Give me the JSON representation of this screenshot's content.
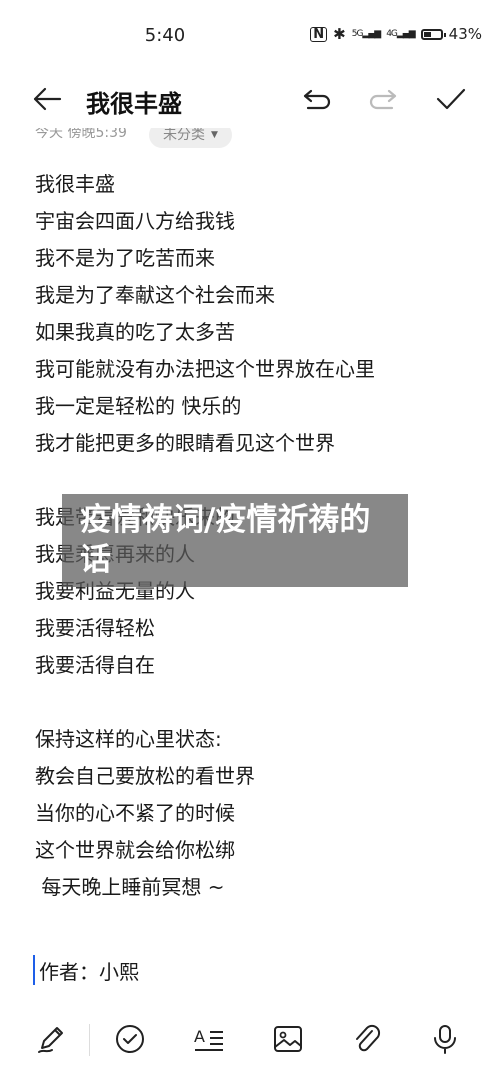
{
  "status_bar": {
    "time": "5:40",
    "battery_percent": "43%",
    "signal_1": "5G",
    "signal_2": "4G"
  },
  "toolbar": {
    "title": "我很丰盛"
  },
  "meta": {
    "date": "今天 傍晚5:39",
    "category": "未分类"
  },
  "note": {
    "lines": [
      "我很丰盛",
      "宇宙会四面八方给我钱",
      "我不是为了吃苦而来",
      "我是为了奉献这个社会而来",
      "如果我真的吃了太多苦",
      "我可能就没有办法把这个世界放在心里",
      "我一定是轻松的 快乐的",
      "我才能把更多的眼睛看见这个世界",
      "",
      "我是带着爱和快乐来的",
      "我是乘愿再来的人",
      "我要利益无量的人",
      "我要活得轻松",
      "我要活得自在",
      "",
      "保持这样的心里状态:",
      "教会自己要放松的看世界",
      "当你的心不紧了的时候",
      "这个世界就会给你松绑",
      " 每天晚上睡前冥想 ~"
    ],
    "author": "作者：小熙"
  },
  "overlay": {
    "text": "疫情祷词/疫情祈祷的话"
  },
  "colors": {
    "accent": "#1e5ee8",
    "overlay_bg": "#5a5a5a"
  }
}
